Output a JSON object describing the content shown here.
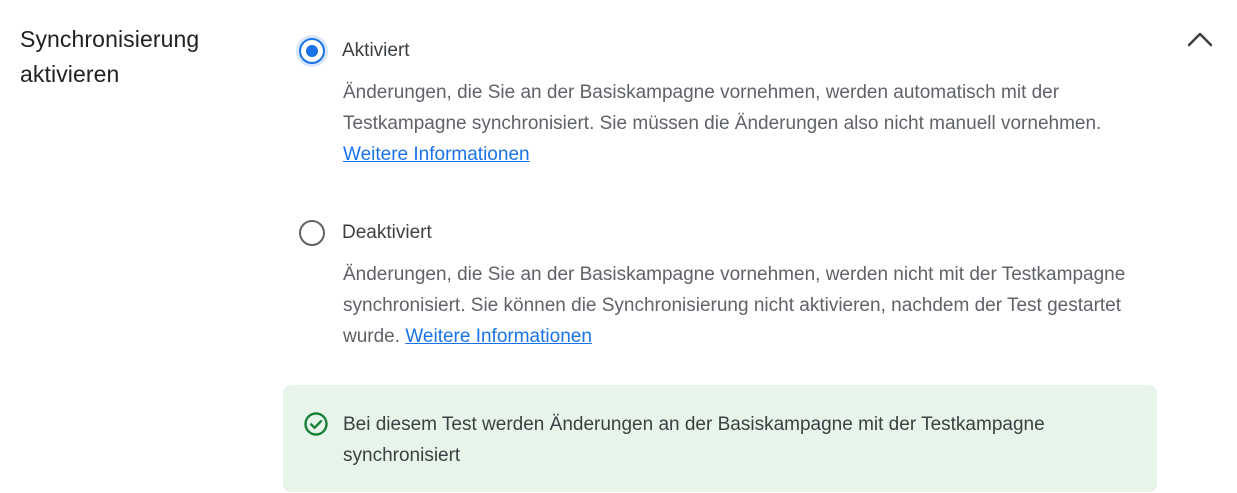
{
  "section": {
    "title_line1": "Synchronisierung",
    "title_line2": "aktivieren",
    "collapse_icon": "chevron-up-icon"
  },
  "options": [
    {
      "label": "Aktiviert",
      "selected": true,
      "description": "Änderungen, die Sie an der Basiskampagne vornehmen, werden automatisch mit der Testkampagne synchronisiert. Sie müssen die Änderungen also nicht manuell vornehmen.",
      "link": "Weitere Informationen"
    },
    {
      "label": "Deaktiviert",
      "selected": false,
      "description": "Änderungen, die Sie an der Basiskampagne vornehmen, werden nicht mit der Testkampagne synchronisiert. Sie können die Synchronisierung nicht aktivieren, nachdem der Test gestartet wurde.",
      "link": "Weitere Informationen"
    }
  ],
  "notice": {
    "icon": "check-circle-icon",
    "text": "Bei diesem Test werden Änderungen an der Basiskampagne mit der Testkampagne synchronisiert"
  },
  "colors": {
    "accent": "#1a73e8",
    "success": "#188038",
    "notice_bg": "#e6f4ea"
  }
}
